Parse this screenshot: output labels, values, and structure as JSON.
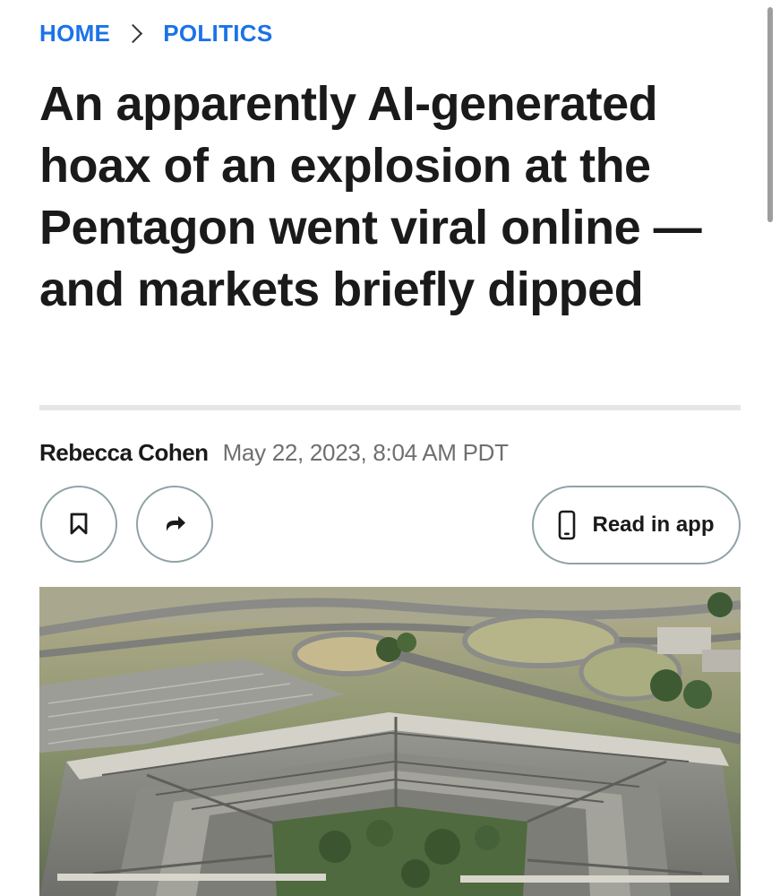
{
  "breadcrumb": {
    "home": "HOME",
    "section": "POLITICS"
  },
  "article": {
    "headline": "An apparently AI-generated hoax of an explosion at the Pentagon went viral online — and markets briefly dipped",
    "author": "Rebecca Cohen",
    "date": "May 22, 2023, 8:04 AM PDT"
  },
  "actions": {
    "read_in_app": "Read in app",
    "bookmark_icon": "bookmark-icon",
    "share_icon": "share-arrow-icon",
    "phone_icon": "phone-icon"
  },
  "colors": {
    "link": "#1a73e8",
    "text": "#1a1a1a",
    "muted": "#6f6f6f",
    "button_border": "#8fa3a6"
  }
}
